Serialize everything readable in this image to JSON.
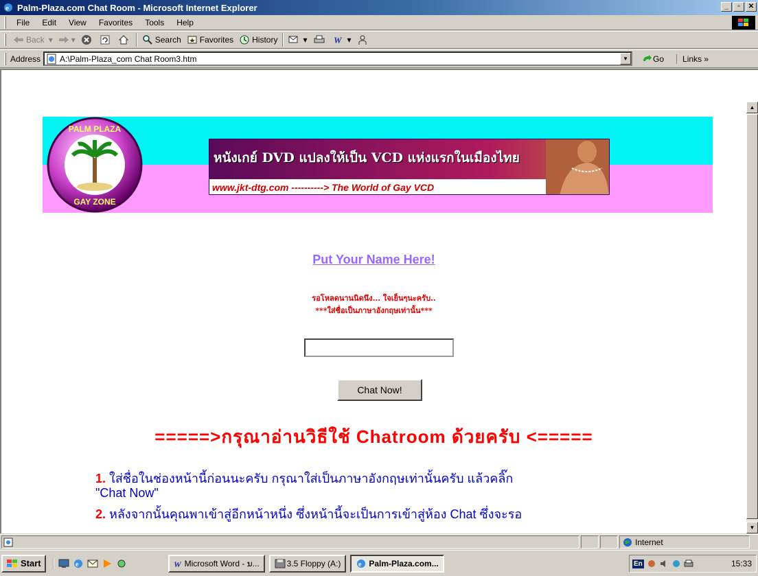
{
  "window": {
    "title": "Palm-Plaza.com Chat Room - Microsoft Internet Explorer",
    "min": "_",
    "max": "▫",
    "close": "✕"
  },
  "menu": [
    "File",
    "Edit",
    "View",
    "Favorites",
    "Tools",
    "Help"
  ],
  "toolbar": {
    "back": "Back",
    "search": "Search",
    "favorites": "Favorites",
    "history": "History"
  },
  "address": {
    "label": "Address",
    "value": "A:\\Palm-Plaza_com Chat Room3.htm",
    "go": "Go",
    "links": "Links"
  },
  "page": {
    "logo_text_top": "PALM PLAZA",
    "logo_text_bottom": "GAY ZONE",
    "ad_headline": "หนังเกย์ DVD แปลงให้เป็น VCD แห่งแรกในเมืองไทย",
    "ad_url": "www.jkt-dtg.com ----------> The World of Gay VCD",
    "put_name_link": "Put Your Name Here!",
    "note_line1": "รอโหลดนานนิดนึง... ใจเย็นๆนะครับ..",
    "note_line2": "***ใส่ชื่อเป็นภาษาอังกฤษเท่านั้น***",
    "name_input_value": "",
    "chat_button": "Chat Now!",
    "howto_heading": "=====>กรุณาอ่านวิธีใช้ Chatroom ด้วยครับ <=====",
    "steps": [
      {
        "num": "1.",
        "text": "ใส่ชื่อในช่องหน้านี้ก่อนนะครับ กรุณาใส่เป็นภาษาอังกฤษเท่านั้นครับ แล้วคลิ๊ก",
        "cont": "\"Chat Now\""
      },
      {
        "num": "2.",
        "text": "หลังจากนั้นคุณพาเข้าสู่อีกหน้าหนึ่ง ซึ่งหน้านี้จะเป็นการเข้าสู่ห้อง Chat ซึ่งจะรอ"
      }
    ]
  },
  "status": {
    "zone": "Internet"
  },
  "taskbar": {
    "start": "Start",
    "tasks": [
      "Microsoft Word - ນ...",
      "3.5 Floppy (A:)",
      "Palm-Plaza.com..."
    ],
    "lang": "En",
    "clock": "15:33"
  },
  "colors": {
    "banner_cyan": "#00f2f2",
    "banner_pink": "#ff99ff",
    "link_purple": "#9966ff",
    "heading_red": "#ff0000",
    "step_blue": "#0000cc"
  }
}
